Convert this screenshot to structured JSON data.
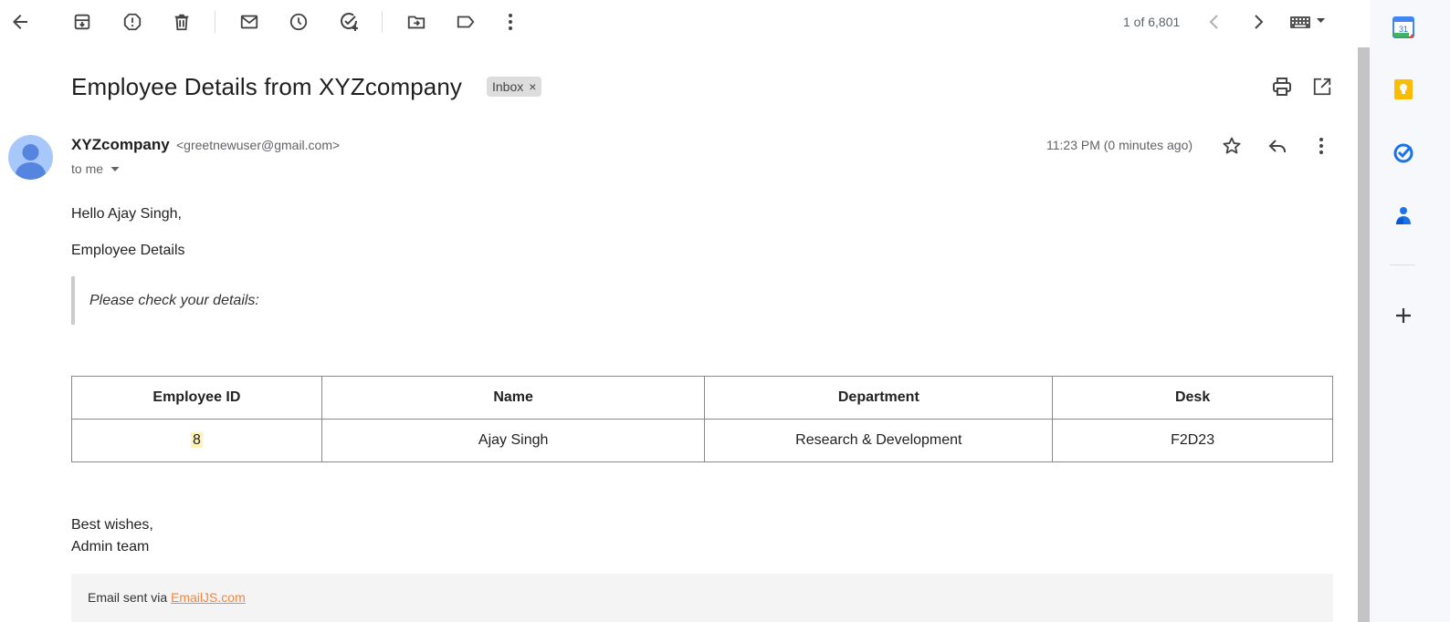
{
  "toolbar": {
    "icons": [
      "back-arrow-icon",
      "archive-icon",
      "report-spam-icon",
      "delete-icon",
      "mark-unread-icon",
      "snooze-icon",
      "add-to-tasks-icon",
      "move-to-icon",
      "labels-icon",
      "more-vert-icon"
    ],
    "pager": "1 of 6,801"
  },
  "email": {
    "subject": "Employee Details from XYZcompany",
    "label_chip": "Inbox",
    "label_remove": "×",
    "sender_name": "XYZcompany",
    "sender_email": "<greetnewuser@gmail.com>",
    "to_line": "to me",
    "timestamp": "11:23 PM (0 minutes ago)"
  },
  "body": {
    "greeting": "Hello Ajay Singh,",
    "heading": "Employee Details",
    "quote": "Please check your details:",
    "table": {
      "headers": [
        "Employee ID",
        "Name",
        "Department",
        "Desk"
      ],
      "rows": [
        [
          "8",
          "Ajay Singh",
          "Research & Development",
          "F2D23"
        ]
      ]
    },
    "signoff_1": "Best wishes,",
    "signoff_2": "Admin team",
    "footer_prefix": "Email sent via",
    "footer_link": "EmailJS.com"
  },
  "side_panel": {
    "calendar_day": "31",
    "apps": [
      "calendar-icon",
      "keep-icon",
      "tasks-icon",
      "contacts-icon",
      "add-addon-icon"
    ]
  },
  "colors": {
    "link": "#f6853b",
    "highlight": "#fff4b8",
    "avatar": "#a8c7fa"
  }
}
